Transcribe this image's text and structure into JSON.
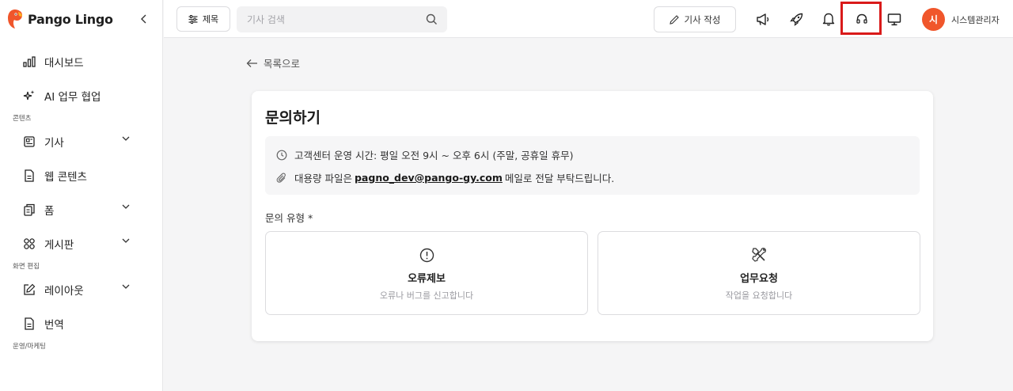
{
  "app": {
    "name": "Pango Lingo",
    "brand_color": "#f0562b",
    "highlight_color": "#d91a1a"
  },
  "sidebar": {
    "items": [
      {
        "label": "대시보드",
        "icon": "bar-chart-icon"
      },
      {
        "label": "AI 업무 협업",
        "icon": "sparkle-icon"
      }
    ],
    "sections": [
      {
        "title": "콘텐츠",
        "items": [
          {
            "label": "기사",
            "icon": "newspaper-icon",
            "expandable": true
          },
          {
            "label": "웹 콘텐츠",
            "icon": "document-icon"
          },
          {
            "label": "폼",
            "icon": "clipboard-icon",
            "expandable": true
          },
          {
            "label": "게시판",
            "icon": "grid-icon",
            "expandable": true
          }
        ]
      },
      {
        "title": "화면 편집",
        "items": [
          {
            "label": "레이아웃",
            "icon": "pencil-square-icon",
            "expandable": true
          },
          {
            "label": "번역",
            "icon": "document-icon"
          }
        ]
      },
      {
        "title": "운영/마케팅",
        "items": []
      }
    ]
  },
  "topbar": {
    "title_button": "제목",
    "search_placeholder": "기사 검색",
    "write_button": "기사 작성",
    "icons": [
      "megaphone-icon",
      "rocket-icon",
      "bell-icon",
      "headset-icon",
      "monitor-icon"
    ],
    "avatar_initial": "시",
    "username": "시스템관리자"
  },
  "main": {
    "back_link": "목록으로",
    "card": {
      "title": "문의하기",
      "info": {
        "hours": "고객센터 운영 시간: 평일 오전 9시 ~ 오후 6시 (주말, 공휴일 휴무)",
        "file_prefix": "대용량 파일은",
        "email": "pagno_dev@pango-gy.com",
        "file_suffix": "메일로 전달 부탁드립니다."
      },
      "type_label": "문의 유형 *",
      "types": [
        {
          "name": "오류제보",
          "desc": "오류나 버그를 신고합니다",
          "icon": "alert-circle-icon"
        },
        {
          "name": "업무요청",
          "desc": "작업을 요청합니다",
          "icon": "tools-icon"
        }
      ]
    }
  }
}
